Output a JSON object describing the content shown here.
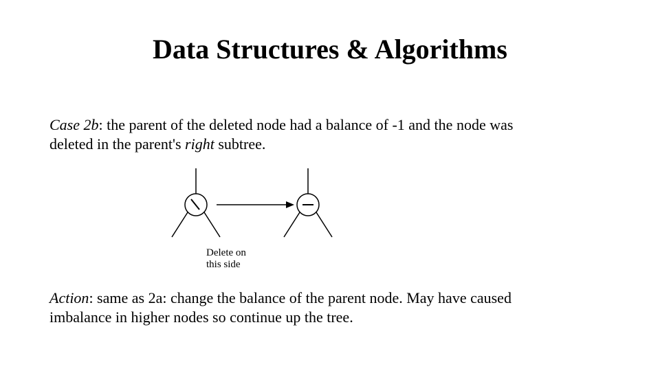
{
  "title": "Data Structures & Algorithms",
  "case": {
    "label": "Case 2b",
    "text_before_right": ": the parent of the deleted node had a balance of -1 and the node was deleted in the parent's ",
    "right_word": "right",
    "text_after_right": " subtree."
  },
  "diagram": {
    "caption_line1": "Delete on",
    "caption_line2": "this side",
    "left_node_tick": "\\",
    "right_node_tick": "—"
  },
  "action": {
    "label": "Action",
    "text": ": same as 2a: change the balance of the parent node. May have caused imbalance in higher nodes so continue up the tree."
  }
}
